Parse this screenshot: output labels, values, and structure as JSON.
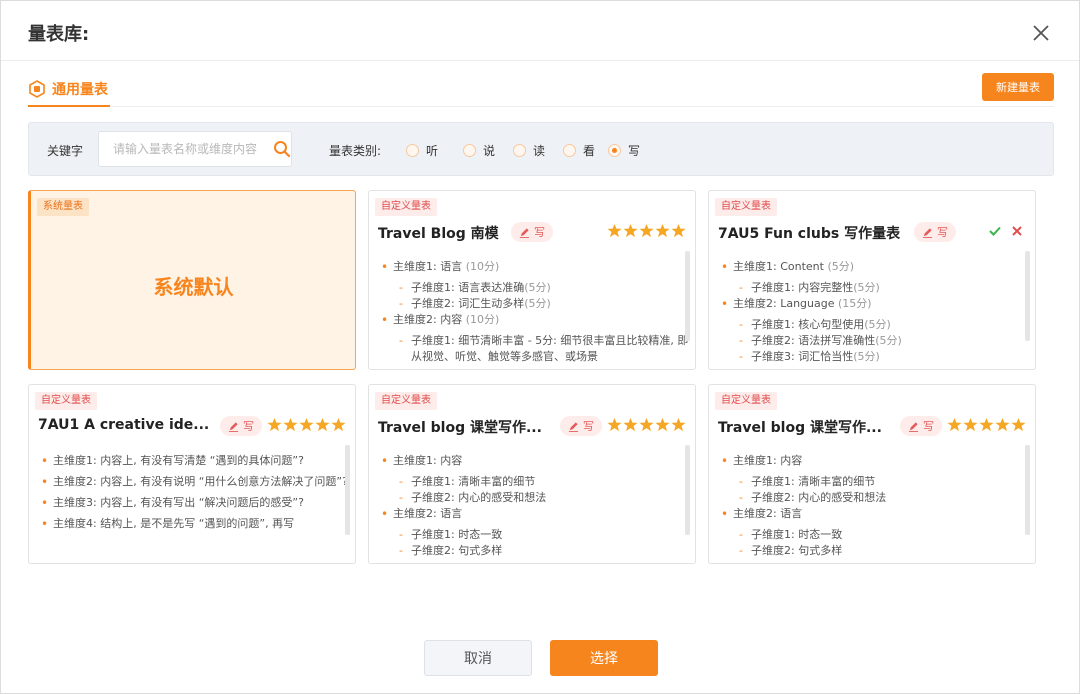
{
  "dialog": {
    "title": "量表库:"
  },
  "tab": {
    "label": "通用量表"
  },
  "new_button": "新建量表",
  "filter": {
    "keyword_label": "关键字",
    "keyword_placeholder": "请输入量表名称或维度内容",
    "keyword_value": "",
    "type_label": "量表类别:",
    "types": [
      {
        "label": "听",
        "selected": false
      },
      {
        "label": "说",
        "selected": false
      },
      {
        "label": "读",
        "selected": false
      },
      {
        "label": "看",
        "selected": false
      },
      {
        "label": "写",
        "selected": true
      }
    ]
  },
  "cards": [
    {
      "tag": "系统量表",
      "system_text": "系统默认"
    },
    {
      "tag": "自定义量表",
      "title": "Travel Blog 南模",
      "skill": "写",
      "stars": 5,
      "lines": [
        {
          "kind": "dim",
          "text": "主维度1: 语言 ",
          "pts": "(10分)"
        },
        {
          "kind": "sub",
          "text": "子维度1:  语言表达准确",
          "pts": "(5分)"
        },
        {
          "kind": "sub",
          "text": "子维度2:  词汇生动多样",
          "pts": "(5分)"
        },
        {
          "kind": "dim",
          "text": "主维度2: 内容 ",
          "pts": "(10分)"
        },
        {
          "kind": "sub",
          "text": "子维度1:  细节清晰丰富 - 5分: 细节很丰富且比较精准, 即从视觉、听觉、触觉等多感官、或场景",
          "pts": ""
        }
      ]
    },
    {
      "tag": "自定义量表",
      "title": "7AU5 Fun clubs 写作量表",
      "skill": "写",
      "stars": 0,
      "lines": [
        {
          "kind": "dim",
          "text": "主维度1: Content ",
          "pts": "(5分)"
        },
        {
          "kind": "sub",
          "text": "子维度1:  内容完整性",
          "pts": "(5分)"
        },
        {
          "kind": "dim",
          "text": "主维度2: Language ",
          "pts": "(15分)"
        },
        {
          "kind": "sub",
          "text": "子维度1:  核心句型使用",
          "pts": "(5分)"
        },
        {
          "kind": "sub",
          "text": "子维度2:  语法拼写准确性",
          "pts": "(5分)"
        },
        {
          "kind": "sub",
          "text": "子维度3:  词汇恰当性",
          "pts": "(5分)"
        }
      ]
    },
    {
      "tag": "自定义量表",
      "title": "7AU1 A creative ide...",
      "skill": "写",
      "stars": 5,
      "lines": [
        {
          "kind": "dim",
          "text": "主维度1: 内容上, 有没有写清楚 “遇到的具体问题”?",
          "pts": ""
        },
        {
          "kind": "dim",
          "text": "主维度2: 内容上, 有没有说明 “用什么创意方法解决了问题”?",
          "pts": ""
        },
        {
          "kind": "dim",
          "text": "主维度3: 内容上, 有没有写出 “解决问题后的感受”?",
          "pts": ""
        },
        {
          "kind": "dim",
          "text": "主维度4: 结构上, 是不是先写 “遇到的问题”, 再写",
          "pts": ""
        }
      ]
    },
    {
      "tag": "自定义量表",
      "title": "Travel blog 课堂写作...",
      "skill": "写",
      "stars": 5,
      "lines": [
        {
          "kind": "dim",
          "text": "主维度1: 内容",
          "pts": ""
        },
        {
          "kind": "sub",
          "text": "子维度1:  清晰丰富的细节",
          "pts": ""
        },
        {
          "kind": "sub",
          "text": "子维度2:  内心的感受和想法",
          "pts": ""
        },
        {
          "kind": "dim",
          "text": "主维度2: 语言",
          "pts": ""
        },
        {
          "kind": "sub",
          "text": "子维度1:  时态一致",
          "pts": ""
        },
        {
          "kind": "sub",
          "text": "子维度2:  句式多样",
          "pts": ""
        }
      ]
    },
    {
      "tag": "自定义量表",
      "title": "Travel blog 课堂写作...",
      "skill": "写",
      "stars": 5,
      "lines": [
        {
          "kind": "dim",
          "text": "主维度1: 内容",
          "pts": ""
        },
        {
          "kind": "sub",
          "text": "子维度1:  清晰丰富的细节",
          "pts": ""
        },
        {
          "kind": "sub",
          "text": "子维度2:  内心的感受和想法",
          "pts": ""
        },
        {
          "kind": "dim",
          "text": "主维度2: 语言",
          "pts": ""
        },
        {
          "kind": "sub",
          "text": "子维度1:  时态一致",
          "pts": ""
        },
        {
          "kind": "sub",
          "text": "子维度2:  句式多样",
          "pts": ""
        }
      ]
    }
  ],
  "footer": {
    "cancel": "取消",
    "confirm": "选择"
  },
  "colors": {
    "accent": "#f7851e",
    "custom_tag": "#e14b4b",
    "star": "#f5a623"
  }
}
